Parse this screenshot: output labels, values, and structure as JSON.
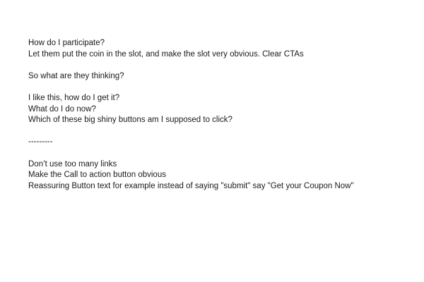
{
  "notes": {
    "block1": [
      "How do I participate?",
      "Let them put the coin in the slot, and make the slot very obvious. Clear CTAs"
    ],
    "block2": [
      "So what are they thinking?"
    ],
    "block3": [
      "I like this, how do I get it?",
      "What do I do now?",
      "Which of these big shiny buttons am I supposed to click?"
    ],
    "separator": "---------",
    "block4": [
      "Don’t use too many links",
      "Make the Call to action button obvious",
      "Reassuring Button text for example instead of saying \"submit\" say \"Get your Coupon Now\""
    ]
  }
}
